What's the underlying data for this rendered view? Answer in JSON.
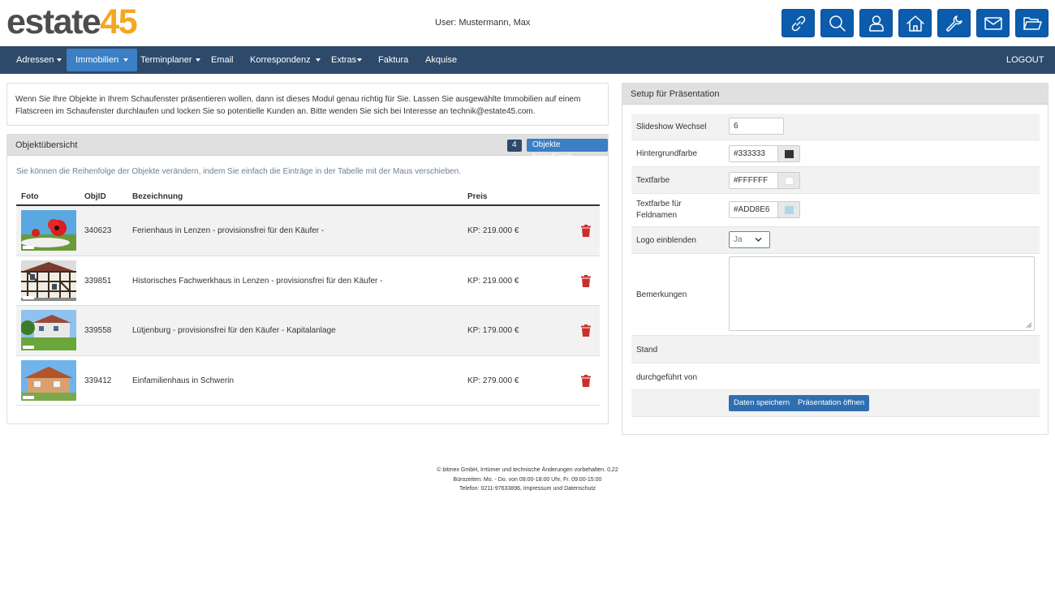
{
  "header": {
    "logo_part1": "estate",
    "logo_part2": "45",
    "user_text": "User: Mustermann, Max",
    "icons": [
      "link-icon",
      "search-icon",
      "user-icon",
      "home-icon",
      "wrench-icon",
      "mail-icon",
      "folder-icon"
    ]
  },
  "nav": {
    "items": [
      "Adressen",
      "Immobilien",
      "Terminplaner",
      "Email",
      "Korrespondenz",
      "Extras",
      "Faktura",
      "Akquise"
    ],
    "logout": "LOGOUT",
    "active": "Immobilien"
  },
  "intro": {
    "text": "Wenn Sie Ihre Objekte in Ihrem Schaufenster präsentieren wollen, dann ist dieses Modul genau richtig für Sie. Lassen Sie ausgewählte Immobilien auf einem Flatscreen im Schaufenster durchlaufen und locken Sie so potentielle Kunden an. Bitte wenden Sie sich bei Interesse an technik@estate45.com."
  },
  "objects": {
    "title": "Objektübersicht",
    "count": "4",
    "add_label": "Objekte hinzufügen",
    "hint": "Sie können die Reihenfolge der Objekte verändern, indem Sie einfach die Einträge in der Tabelle mit der Maus verschieben.",
    "columns": [
      "Foto",
      "ObjID",
      "Bezeichnung",
      "Preis"
    ],
    "rows": [
      {
        "id": "340623",
        "name": "Ferienhaus in Lenzen - provisionsfrei für den Käufer -",
        "price": "KP: 219.000 €"
      },
      {
        "id": "339851",
        "name": "Historisches Fachwerkhaus in Lenzen - provisionsfrei für den Käufer -",
        "price": "KP: 219.000 €"
      },
      {
        "id": "339558",
        "name": "Lütjenburg - provisionsfrei für den Käufer - Kapitalanlage",
        "price": "KP: 179.000 €"
      },
      {
        "id": "339412",
        "name": "Einfamilienhaus in Schwerin",
        "price": "KP: 279.000 €"
      }
    ]
  },
  "setup": {
    "title": "Setup für Präsentation",
    "slideshow_label": "Slideshow Wechsel",
    "slideshow_value": "6",
    "bg_label": "Hintergrundfarbe",
    "bg_value": "#333333",
    "text_label": "Textfarbe",
    "text_value": "#FFFFFF",
    "field_label_1": "Textfarbe für",
    "field_label_2": "Feldnamen",
    "field_value": "#ADD8E6",
    "logo_label": "Logo einblenden",
    "logo_value": "Ja",
    "remarks_label": "Bemerkungen",
    "stand_label": "Stand",
    "done_label": "durchgeführt von",
    "save_label": "Daten speichern",
    "open_label": "Präsentation öffnen"
  },
  "footer": {
    "line1": "© bitmex GmbH, Irrtümer und technische Änderungen vorbehalten. 0,22",
    "line2": "Bürozeiten: Mo. - Do. von 09:00-18:00 Uhr, Fr. 09:00-15:00",
    "line3": "Telefon: 0211-97633896, Impressum und Datenschutz"
  },
  "colors": {
    "brand_blue": "#0b5cad",
    "navbar": "#2d4a6b",
    "nav_active": "#3b7fc4",
    "logo_orange": "#f5a623",
    "trash_red": "#c9302c"
  }
}
